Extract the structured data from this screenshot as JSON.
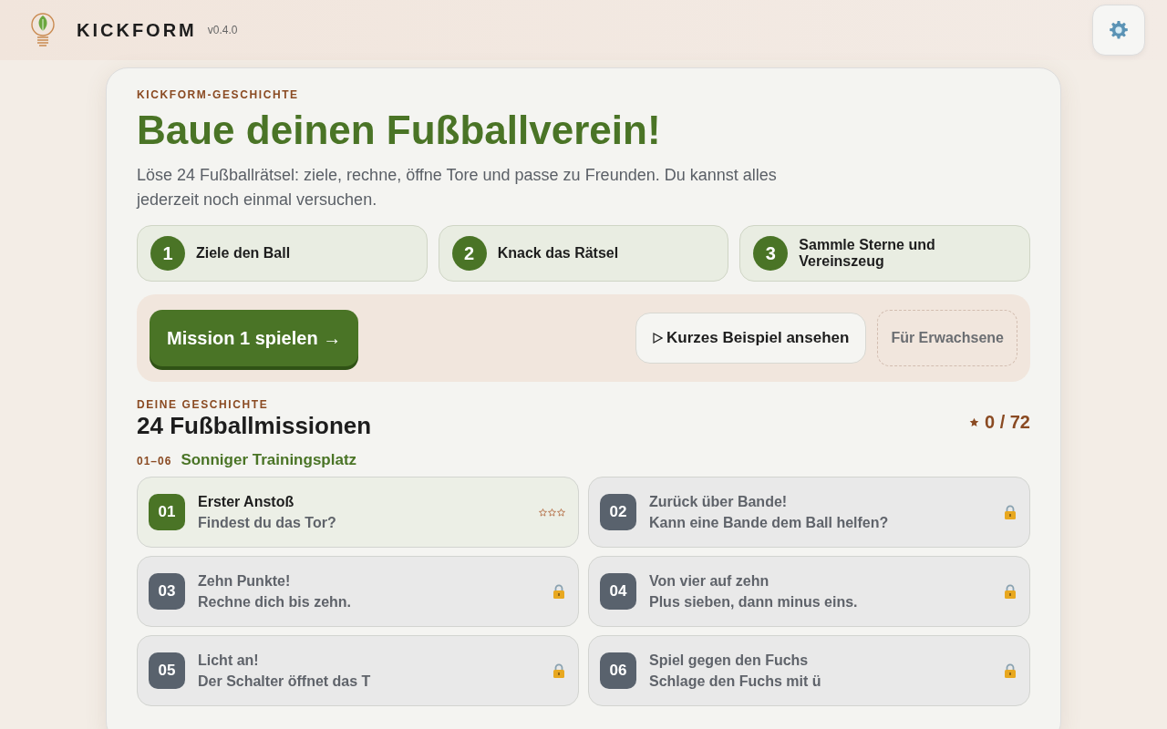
{
  "header": {
    "app_name": "KICKFORM",
    "version": "v0.4.0"
  },
  "intro": {
    "eyebrow": "KICKFORM-GESCHICHTE",
    "title": "Baue deinen Fußballverein!",
    "description": "Löse 24 Fußballrätsel: ziele, rechne, öffne Tore und passe zu Freunden. Du kannst alles jederzeit noch einmal versuchen."
  },
  "steps": [
    {
      "number": "1",
      "label": "Ziele den Ball"
    },
    {
      "number": "2",
      "label": "Knack das Rätsel"
    },
    {
      "number": "3",
      "label": "Sammle Sterne und Vereinszeug"
    }
  ],
  "actions": {
    "play": "Mission 1 spielen →",
    "example": "Kurzes Beispiel ansehen",
    "adults": "Für Erwachsene"
  },
  "story": {
    "eyebrow": "DEINE GESCHICHTE",
    "title": "24 Fußballmissionen",
    "star_total": "0 / 72"
  },
  "chapter": {
    "range": "01–06",
    "name": "Sonniger Trainingsplatz"
  },
  "missions": [
    {
      "number": "01",
      "title": "Erster Anstoß",
      "subtitle": "Findest du das Tor?",
      "locked": false,
      "stars": 0
    },
    {
      "number": "02",
      "title": "Zurück über Bande!",
      "subtitle": "Kann eine Bande dem Ball helfen?",
      "locked": true
    },
    {
      "number": "03",
      "title": "Zehn Punkte!",
      "subtitle": "Rechne dich bis zehn.",
      "locked": true
    },
    {
      "number": "04",
      "title": "Von vier auf zehn",
      "subtitle": "Plus sieben, dann minus eins.",
      "locked": true
    },
    {
      "number": "05",
      "title": "Licht an!",
      "subtitle": "Der Schalter öffnet das T",
      "locked": true
    },
    {
      "number": "06",
      "title": "Spiel gegen den Fuchs",
      "subtitle": "Schlage den Fuchs mit ü",
      "locked": true
    }
  ]
}
